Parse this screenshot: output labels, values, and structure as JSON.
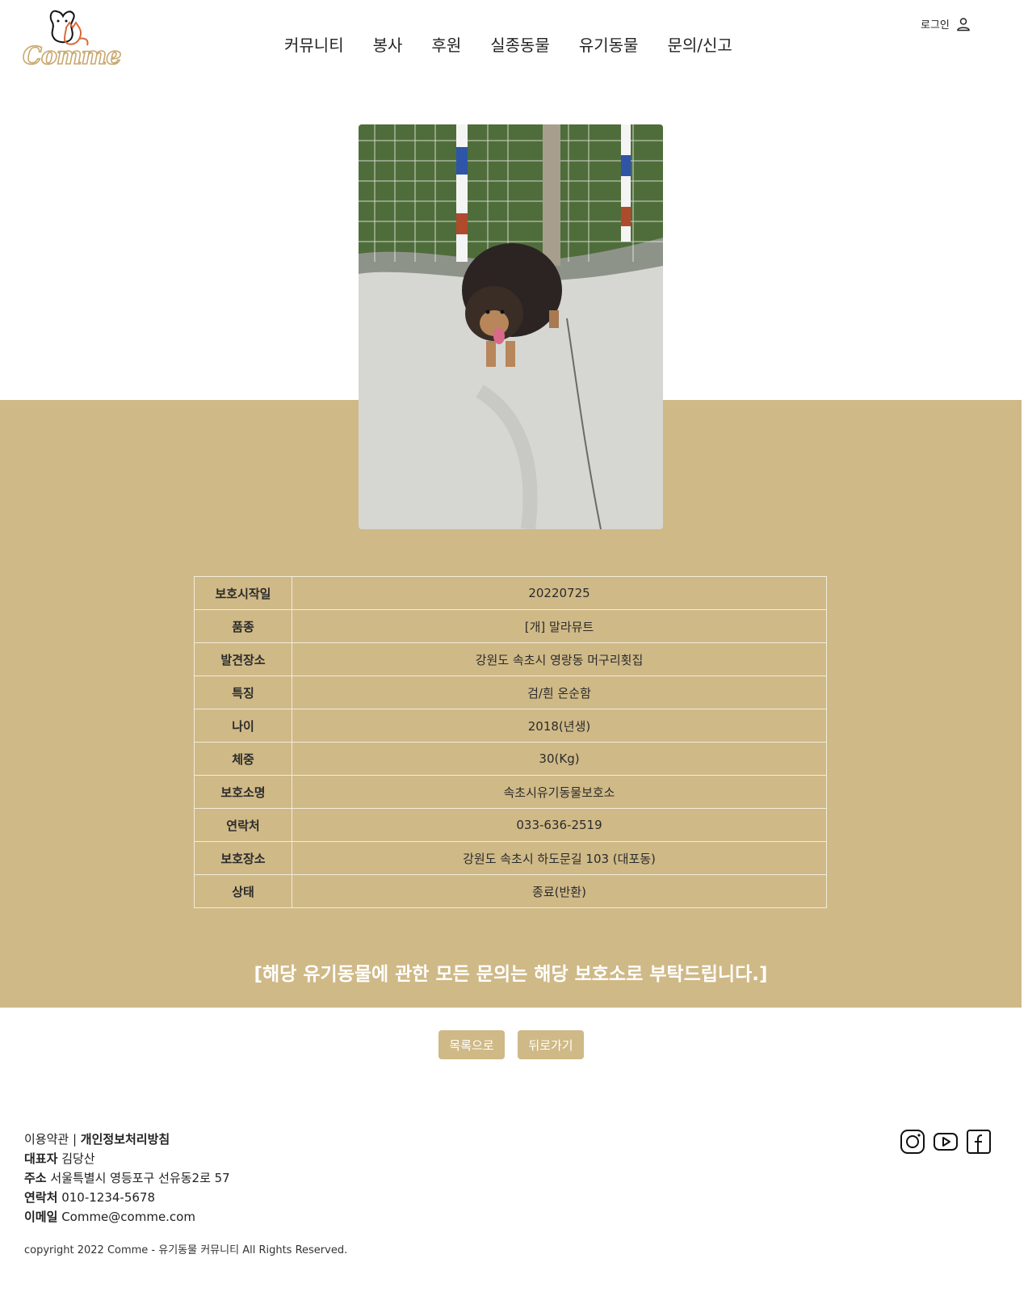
{
  "header": {
    "logo_text": "Comme",
    "nav": [
      "커뮤니티",
      "봉사",
      "후원",
      "실종동물",
      "유기동물",
      "문의/신고"
    ],
    "login_label": "로그인"
  },
  "animal": {
    "photo_icon": "dog-photo",
    "rows": [
      {
        "label": "보호시작일",
        "value": "20220725"
      },
      {
        "label": "품종",
        "value": "[개] 말라뮤트"
      },
      {
        "label": "발견장소",
        "value": "강원도 속초시 영랑동 머구리횟집"
      },
      {
        "label": "특징",
        "value": "검/흰 온순함"
      },
      {
        "label": "나이",
        "value": "2018(년생)"
      },
      {
        "label": "체중",
        "value": "30(Kg)"
      },
      {
        "label": "보호소명",
        "value": "속초시유기동물보호소"
      },
      {
        "label": "연락처",
        "value": "033-636-2519"
      },
      {
        "label": "보호장소",
        "value": "강원도 속초시 하도문길 103 (대포동)"
      },
      {
        "label": "상태",
        "value": "종료(반환)"
      }
    ],
    "notice": "[해당 유기동물에 관한 모든 문의는 해당 보호소로 부탁드립니다.]"
  },
  "buttons": {
    "list_label": "목록으로",
    "back_label": "뒤로가기"
  },
  "footer": {
    "terms": "이용약관",
    "separator": " | ",
    "privacy": "개인정보처리방침",
    "ceo_label": "대표자",
    "ceo_value": "김당산",
    "address_label": "주소",
    "address_value": "서울특별시 영등포구 선유동2로 57",
    "contact_label": "연락처",
    "contact_value": "010-1234-5678",
    "email_label": "이메일",
    "email_value": "Comme@comme.com",
    "copyright": "copyright 2022 Comme - 유기동물 커뮤니티 All Rights Reserved.",
    "social_icons": [
      "instagram-icon",
      "youtube-icon",
      "facebook-icon"
    ]
  },
  "colors": {
    "accent": "#cfb987",
    "logo": "#c9a86f"
  }
}
